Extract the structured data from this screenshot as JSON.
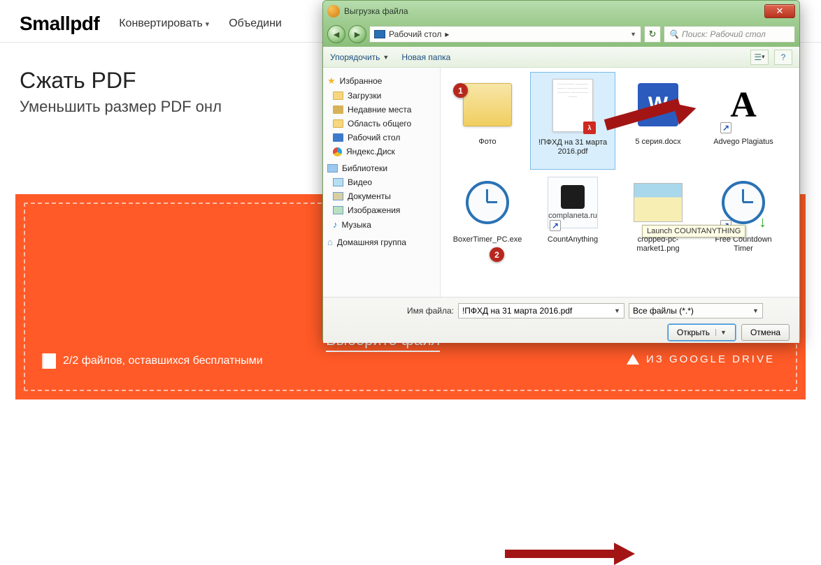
{
  "web": {
    "logo": "Smallpdf",
    "nav": {
      "convert": "Конвертировать",
      "merge": "Объедини"
    },
    "heading": "Сжать PDF",
    "subheading": "Уменьшить размер PDF онл",
    "choose_file": "Выберите файл",
    "files_left": "2/2 файлов, оставшихся бесплатными",
    "google_drive": "ИЗ GOOGLE DRIVE"
  },
  "dialog": {
    "title": "Выгрузка файла",
    "close": "✕",
    "location": "Рабочий стол",
    "search_placeholder": "Поиск: Рабочий стол",
    "toolbar": {
      "organize": "Упорядочить",
      "newfolder": "Новая папка"
    },
    "sidebar": {
      "favorites": "Избранное",
      "downloads": "Загрузки",
      "recent": "Недавние места",
      "shared": "Область общего",
      "desktop": "Рабочий стол",
      "yadisk": "Яндекс.Диск",
      "libraries": "Библиотеки",
      "video": "Видео",
      "documents": "Документы",
      "pictures": "Изображения",
      "music": "Музыка",
      "homegroup": "Домашняя группа"
    },
    "files": [
      {
        "name": "Фото"
      },
      {
        "name": "!ПФХД на 31 марта 2016.pdf"
      },
      {
        "name": "5 серия.docx"
      },
      {
        "name": "Advego Plagiatus"
      },
      {
        "name": "BoxerTimer_PC.exe"
      },
      {
        "name": "CountAnything"
      },
      {
        "name": "cropped-pc-market1.png"
      },
      {
        "name": "Free Countdown Timer"
      }
    ],
    "complaneta_txt": "complaneta.ru",
    "tooltip": "Launch COUNTANYTHING",
    "filename_label": "Имя файла:",
    "filename_value": "!ПФХД на 31 марта 2016.pdf",
    "filter": "Все файлы (*.*)",
    "open": "Открыть",
    "cancel": "Отмена"
  },
  "badges": {
    "b1": "1",
    "b2": "2"
  }
}
